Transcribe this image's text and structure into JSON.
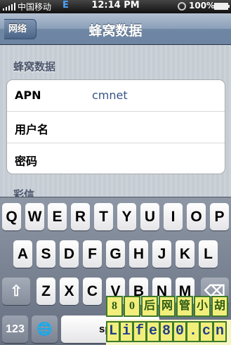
{
  "status_bar": {
    "carrier": "中国移动",
    "network": "E",
    "time": "12:14 PM",
    "battery": "100%"
  },
  "nav": {
    "back_label": "网络",
    "title": "蜂窝数据"
  },
  "section": {
    "header": "蜂窝数据",
    "rows": [
      {
        "label": "APN",
        "value": "cmnet"
      },
      {
        "label": "用户名",
        "value": ""
      },
      {
        "label": "密码",
        "value": ""
      }
    ],
    "next_header_partial": "彩信"
  },
  "keyboard": {
    "row1": [
      "Q",
      "W",
      "E",
      "R",
      "T",
      "Y",
      "U",
      "I",
      "O",
      "P"
    ],
    "row2": [
      "A",
      "S",
      "D",
      "F",
      "G",
      "H",
      "J",
      "K",
      "L"
    ],
    "row3": [
      "Z",
      "X",
      "C",
      "V",
      "B",
      "N",
      "M"
    ],
    "shift_icon": "⇧",
    "delete_icon": "⌫",
    "numbers_label": "123",
    "globe_icon": "🌐",
    "space_label": "sp"
  },
  "watermark": {
    "top_chars": [
      "8",
      "0",
      "后",
      "网",
      "管",
      "小",
      "胡"
    ],
    "bottom_chars": [
      "L",
      "i",
      "f",
      "e",
      "8",
      "0",
      ".",
      "c",
      "n"
    ]
  },
  "colors": {
    "nav_blue": "#6d84a2",
    "value_blue": "#385487",
    "section_text": "#4c566c"
  }
}
